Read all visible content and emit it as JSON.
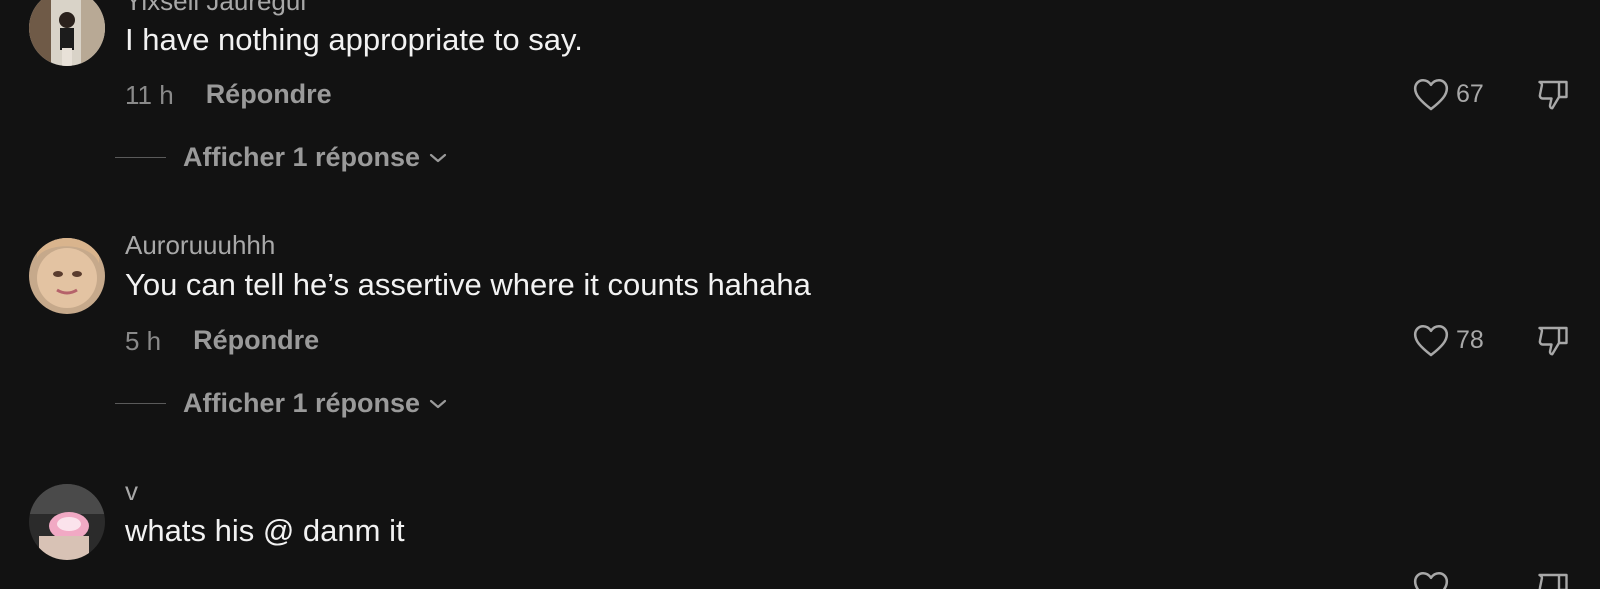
{
  "comments": [
    {
      "username": "Yixsell Jauregui",
      "text": "I have nothing appropriate to say.",
      "time": "11 h",
      "reply_label": "Répondre",
      "likes": "67",
      "show_replies_label": "Afficher 1 réponse"
    },
    {
      "username": "Auroruuuhhh",
      "text": "You can tell he’s assertive where it counts hahaha",
      "time": "5 h",
      "reply_label": "Répondre",
      "likes": "78",
      "show_replies_label": "Afficher 1 réponse"
    },
    {
      "username": "v",
      "text": "whats his @ danm it"
    }
  ],
  "icons": {
    "like": "heart-outline-icon",
    "dislike": "thumbs-down-outline-icon",
    "expand": "chevron-down-icon"
  },
  "colors": {
    "background": "#121212",
    "primary_text": "#f2f2f2",
    "secondary_text": "#a8a8a8"
  }
}
